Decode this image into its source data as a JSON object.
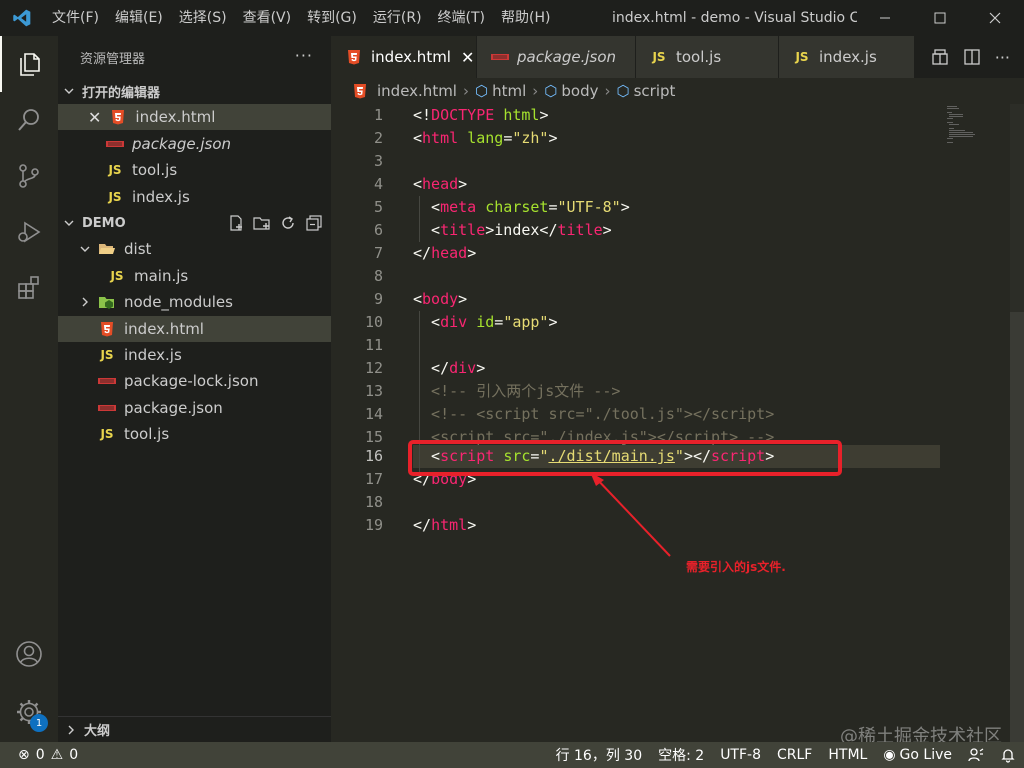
{
  "titlebar": {
    "menu": [
      "文件(F)",
      "编辑(E)",
      "选择(S)",
      "查看(V)",
      "转到(G)",
      "运行(R)",
      "终端(T)",
      "帮助(H)"
    ],
    "window_title": "index.html - demo - Visual Studio C..."
  },
  "activity": {
    "badge_count": "1"
  },
  "sidebar": {
    "header": "资源管理器",
    "more": "···",
    "open_editors_label": "打开的编辑器",
    "open_editors": [
      "index.html",
      "package.json",
      "tool.js",
      "index.js"
    ],
    "project_label": "DEMO",
    "tree": {
      "dist": "dist",
      "main_js": "main.js",
      "node_modules": "node_modules",
      "index_html": "index.html",
      "index_js": "index.js",
      "package_lock": "package-lock.json",
      "package_json": "package.json",
      "tool_js": "tool.js"
    },
    "outline_label": "大纲",
    "js_badge": "JS"
  },
  "tabs": [
    {
      "label": "index.html",
      "active": true
    },
    {
      "label": "package.json",
      "active": false
    },
    {
      "label": "tool.js",
      "active": false
    },
    {
      "label": "index.js",
      "active": false
    }
  ],
  "breadcrumb": [
    "index.html",
    "html",
    "body",
    "script"
  ],
  "editor": {
    "line_numbers": [
      "1",
      "2",
      "3",
      "4",
      "5",
      "6",
      "7",
      "8",
      "9",
      "10",
      "11",
      "12",
      "13",
      "14",
      "15",
      "16",
      "17",
      "18",
      "19"
    ],
    "current_line": "16"
  },
  "annotation": {
    "text": "需要引入的js文件."
  },
  "statusbar": {
    "errors": "0",
    "warnings": "0",
    "position": "行 16，列 30",
    "spaces": "空格: 2",
    "encoding": "UTF-8",
    "eol": "CRLF",
    "language": "HTML",
    "golive": "Go Live"
  },
  "watermark": "@稀土掘金技术社区",
  "colors": {
    "accent_red": "#e8212a",
    "tag": "#f92672",
    "attr": "#a6e22e",
    "string": "#e6db74",
    "comment": "#75715e",
    "js_yellow": "#e8d44d",
    "html_orange": "#e44d26"
  }
}
